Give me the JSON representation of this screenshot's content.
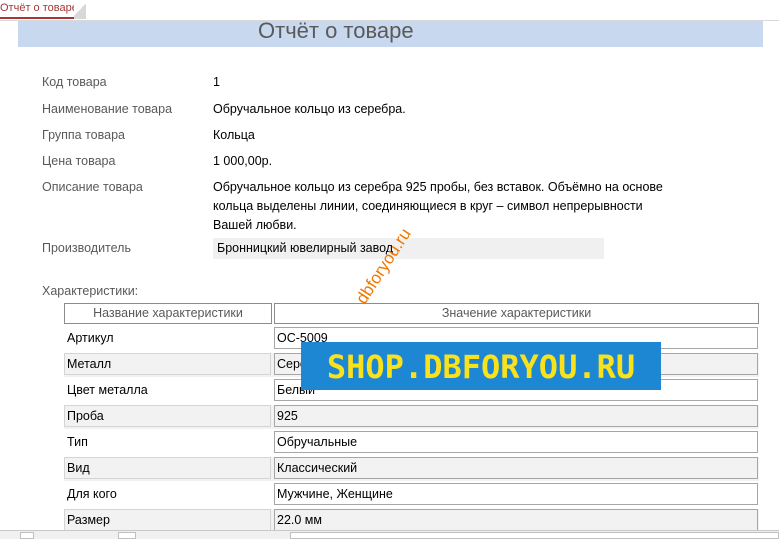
{
  "tab": {
    "label": "Отчёт о товаре"
  },
  "report": {
    "title": "Отчёт о товаре",
    "fields": {
      "code_label": "Код товара",
      "code_value": "1",
      "name_label": "Наименование товара",
      "name_value": "Обручальное кольцо из серебра.",
      "group_label": "Группа товара",
      "group_value": "Кольца",
      "price_label": "Цена товара",
      "price_value": "1 000,00р.",
      "desc_label": "Описание товара",
      "desc_value": "Обручальное кольцо из серебра 925 пробы, без вставок. Объёмно на основе кольца выделены линии, соединяющиеся в круг – символ непрерывности Вашей любви.",
      "manufacturer_label": "Производитель",
      "manufacturer_value": "Бронницкий ювелирный завод"
    },
    "characteristics_label": "Характеристики:",
    "table": {
      "headers": [
        "Название характеристики",
        "Значение характеристики"
      ],
      "rows": [
        {
          "name": "Артикул",
          "value": "ОС-5009"
        },
        {
          "name": "Металл",
          "value": "Серебро"
        },
        {
          "name": "Цвет металла",
          "value": "Белый"
        },
        {
          "name": "Проба",
          "value": "925"
        },
        {
          "name": "Тип",
          "value": "Обручальные"
        },
        {
          "name": "Вид",
          "value": "Классический"
        },
        {
          "name": "Для кого",
          "value": "Мужчине, Женщине"
        },
        {
          "name": "Размер",
          "value": "22.0 мм"
        }
      ]
    }
  },
  "watermarks": {
    "diagonal": "dbforyou.ru",
    "banner": "SHOP.DBFORYOU.RU"
  },
  "colors": {
    "title_band": "#c8d8ee",
    "tab_accent": "#a4373a",
    "banner_bg": "#1d87d4",
    "banner_text": "#f9e21b",
    "diagonal_watermark": "#f07800"
  }
}
